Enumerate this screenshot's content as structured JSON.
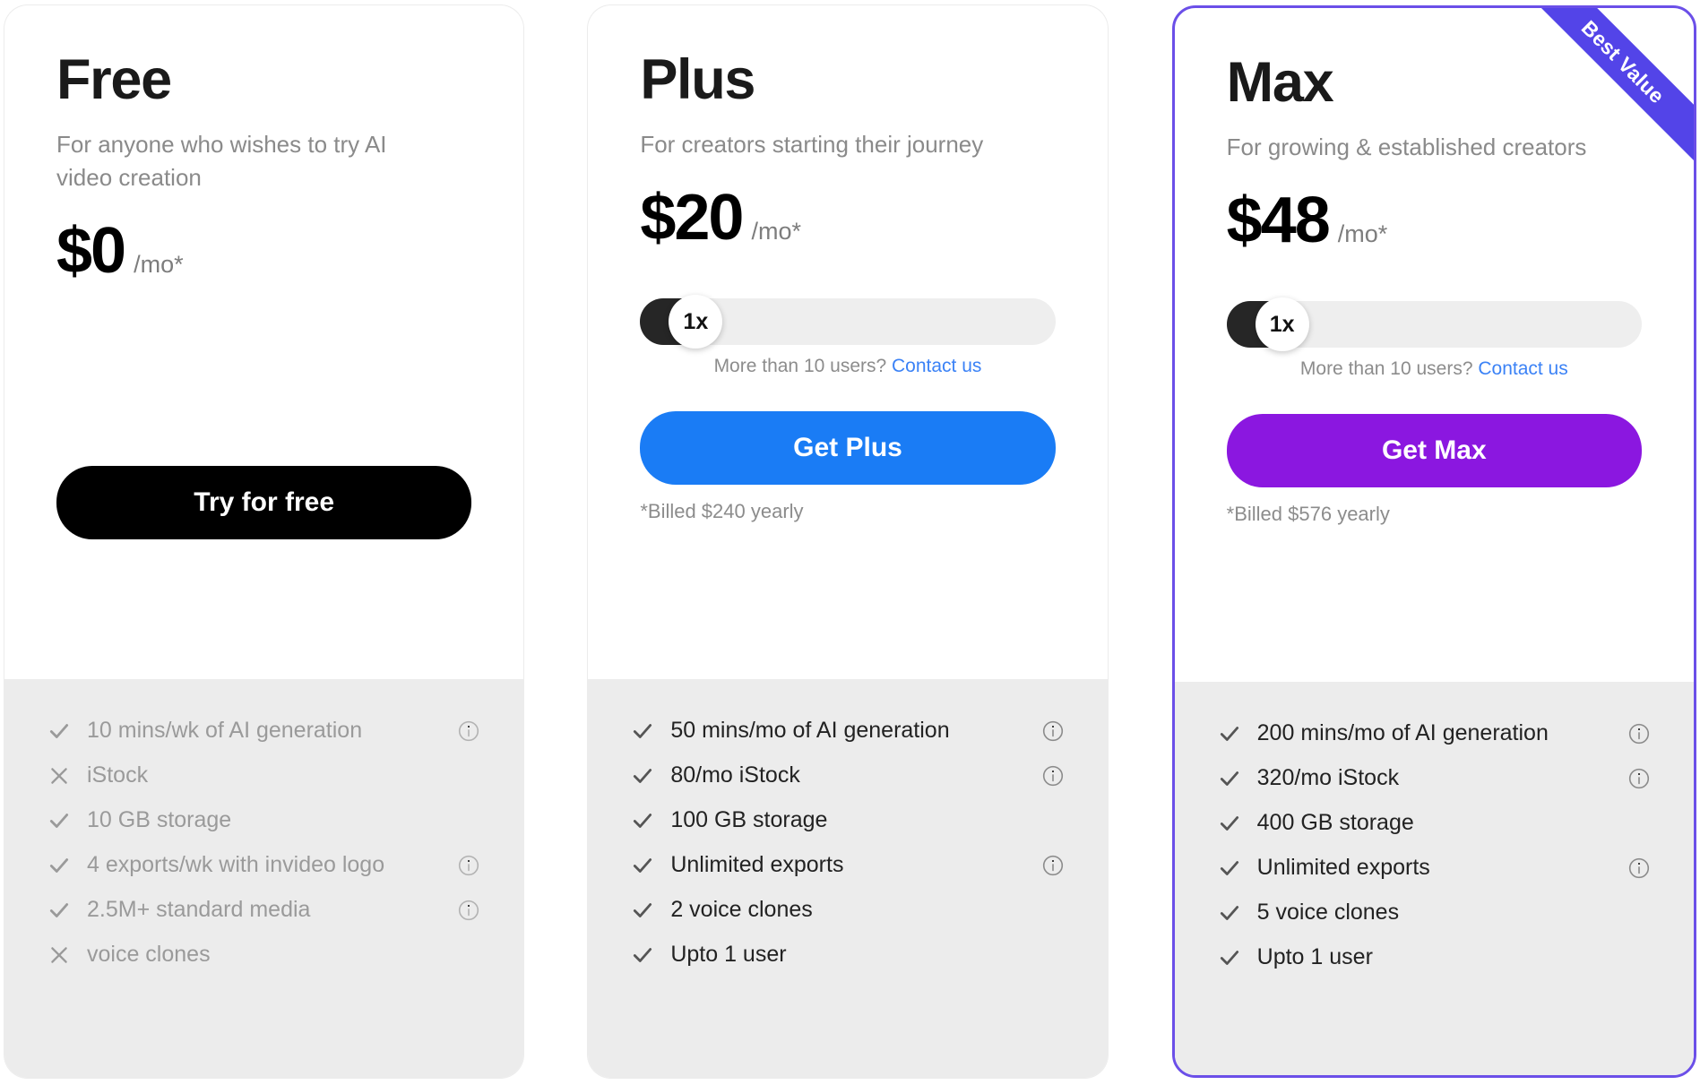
{
  "colors": {
    "free_cta": "#000000",
    "plus_cta": "#1a7cf5",
    "max_cta": "#8b17e0",
    "max_border": "#6b4fe8",
    "ribbon": "#5344e8",
    "link": "#3b82f6",
    "features_bg": "#ececec"
  },
  "plans": [
    {
      "id": "free",
      "name": "Free",
      "tagline": "For anyone who wishes to try AI video creation",
      "price": "$0",
      "period": "/mo*",
      "has_slider": false,
      "slider": null,
      "cta_label": "Try for free",
      "cta_style": "dark",
      "billing_note": "",
      "ribbon": null,
      "features_emphasis": "muted",
      "features": [
        {
          "included": true,
          "text": "10 mins/wk of AI generation",
          "info": true
        },
        {
          "included": false,
          "text": "iStock",
          "info": false
        },
        {
          "included": true,
          "text": "10 GB storage",
          "info": false
        },
        {
          "included": true,
          "text": "4 exports/wk with invideo logo",
          "info": true
        },
        {
          "included": true,
          "text": "2.5M+ standard media",
          "info": true
        },
        {
          "included": false,
          "text": "voice clones",
          "info": false
        }
      ]
    },
    {
      "id": "plus",
      "name": "Plus",
      "tagline": "For creators starting their journey",
      "price": "$20",
      "period": "/mo*",
      "has_slider": true,
      "slider": {
        "value_label": "1x",
        "note_text": "More than 10 users?",
        "note_link": "Contact us"
      },
      "cta_label": "Get Plus",
      "cta_style": "blue",
      "billing_note": "*Billed $240 yearly",
      "ribbon": null,
      "features_emphasis": "strong",
      "features": [
        {
          "included": true,
          "text": "50 mins/mo of AI generation",
          "info": true
        },
        {
          "included": true,
          "text": "80/mo iStock",
          "info": true
        },
        {
          "included": true,
          "text": "100 GB storage",
          "info": false
        },
        {
          "included": true,
          "text": "Unlimited exports",
          "info": true
        },
        {
          "included": true,
          "text": "2 voice clones",
          "info": false
        },
        {
          "included": true,
          "text": "Upto 1 user",
          "info": false
        }
      ]
    },
    {
      "id": "max",
      "name": "Max",
      "tagline": "For growing & established creators",
      "price": "$48",
      "period": "/mo*",
      "has_slider": true,
      "slider": {
        "value_label": "1x",
        "note_text": "More than 10 users?",
        "note_link": "Contact us"
      },
      "cta_label": "Get Max",
      "cta_style": "purple",
      "billing_note": "*Billed $576 yearly",
      "ribbon": "Best Value",
      "features_emphasis": "strong",
      "features": [
        {
          "included": true,
          "text": "200 mins/mo of AI generation",
          "info": true
        },
        {
          "included": true,
          "text": "320/mo iStock",
          "info": true
        },
        {
          "included": true,
          "text": "400 GB storage",
          "info": false
        },
        {
          "included": true,
          "text": "Unlimited exports",
          "info": true
        },
        {
          "included": true,
          "text": "5 voice clones",
          "info": false
        },
        {
          "included": true,
          "text": "Upto 1 user",
          "info": false
        }
      ]
    }
  ]
}
